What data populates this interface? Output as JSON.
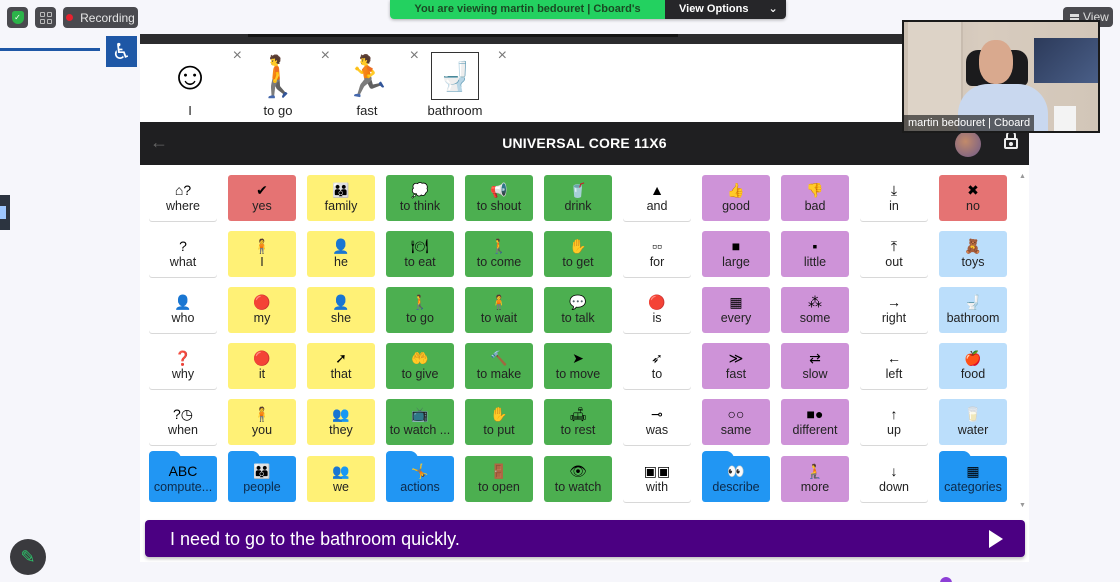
{
  "zoom": {
    "recording_label": "Recording",
    "banner_text": "You are viewing martin bedouret | Cboard's screen",
    "view_options_label": "View Options",
    "view_options_chevron": "⌄",
    "view_label": "View",
    "video_name": "martin bedouret | Cboard",
    "colors": {
      "banner": "#23d160",
      "recording_dot": "#e8212f"
    }
  },
  "left_panel": {
    "access_icon": "wheelchair-icon",
    "access_glyph": "♿",
    "pencil_glyph": "✎"
  },
  "cboard": {
    "output": [
      {
        "label": "I",
        "icon": "person-self-icon",
        "glyph": "☺"
      },
      {
        "label": "to go",
        "icon": "person-walking-icon",
        "glyph": "🚶"
      },
      {
        "label": "fast",
        "icon": "running-fast-icon",
        "glyph": "🏃"
      },
      {
        "label": "bathroom",
        "icon": "toilet-icon",
        "glyph": "🚽"
      }
    ],
    "remove_glyph": "×",
    "board_title": "UNIVERSAL CORE 11X6",
    "back_glyph": "←",
    "phrase": "I need to go to the bathroom quickly.",
    "colors": {
      "phrase_bar": "#4b0082",
      "nav_bar": "#1f1f21",
      "red": "#e57373",
      "yellow": "#fff176",
      "green": "#4caf50",
      "purple": "#ce93d8",
      "light_blue": "#bbdefb",
      "folder_blue": "#2196f3"
    },
    "tiles": [
      [
        {
          "label": "where",
          "type": "white",
          "glyph": "⌂?"
        },
        {
          "label": "yes",
          "type": "red",
          "glyph": "✔"
        },
        {
          "label": "family",
          "type": "yellow",
          "glyph": "👪"
        },
        {
          "label": "to think",
          "type": "green",
          "glyph": "💭"
        },
        {
          "label": "to shout",
          "type": "green",
          "glyph": "📢"
        },
        {
          "label": "drink",
          "type": "green",
          "glyph": "🥤"
        },
        {
          "label": "and",
          "type": "white",
          "glyph": "▲"
        },
        {
          "label": "good",
          "type": "purple",
          "glyph": "👍"
        },
        {
          "label": "bad",
          "type": "purple",
          "glyph": "👎"
        },
        {
          "label": "in",
          "type": "white",
          "glyph": "⤓"
        },
        {
          "label": "no",
          "type": "red",
          "glyph": "✖"
        }
      ],
      [
        {
          "label": "what",
          "type": "white",
          "glyph": "?"
        },
        {
          "label": "I",
          "type": "yellow",
          "glyph": "🧍"
        },
        {
          "label": "he",
          "type": "yellow",
          "glyph": "👤"
        },
        {
          "label": "to eat",
          "type": "green",
          "glyph": "🍽"
        },
        {
          "label": "to come",
          "type": "green",
          "glyph": "🚶"
        },
        {
          "label": "to get",
          "type": "green",
          "glyph": "✋"
        },
        {
          "label": "for",
          "type": "white",
          "glyph": "▫▫"
        },
        {
          "label": "large",
          "type": "purple",
          "glyph": "■"
        },
        {
          "label": "little",
          "type": "purple",
          "glyph": "▪"
        },
        {
          "label": "out",
          "type": "white",
          "glyph": "⤒"
        },
        {
          "label": "toys",
          "type": "lightblue",
          "glyph": "🧸"
        }
      ],
      [
        {
          "label": "who",
          "type": "white",
          "glyph": "👤"
        },
        {
          "label": "my",
          "type": "yellow",
          "glyph": "🔴"
        },
        {
          "label": "she",
          "type": "yellow",
          "glyph": "👤"
        },
        {
          "label": "to go",
          "type": "green",
          "glyph": "🚶"
        },
        {
          "label": "to wait",
          "type": "green",
          "glyph": "🧍"
        },
        {
          "label": "to talk",
          "type": "green",
          "glyph": "💬"
        },
        {
          "label": "is",
          "type": "white",
          "glyph": "🔴"
        },
        {
          "label": "every",
          "type": "purple",
          "glyph": "▦"
        },
        {
          "label": "some",
          "type": "purple",
          "glyph": "⁂"
        },
        {
          "label": "right",
          "type": "white",
          "glyph": "→"
        },
        {
          "label": "bathroom",
          "type": "lightblue",
          "glyph": "🚽"
        }
      ],
      [
        {
          "label": "why",
          "type": "white",
          "glyph": "❓"
        },
        {
          "label": "it",
          "type": "yellow",
          "glyph": "🔴"
        },
        {
          "label": "that",
          "type": "yellow",
          "glyph": "➚"
        },
        {
          "label": "to give",
          "type": "green",
          "glyph": "🤲"
        },
        {
          "label": "to make",
          "type": "green",
          "glyph": "🔨"
        },
        {
          "label": "to move",
          "type": "green",
          "glyph": "➤"
        },
        {
          "label": "to",
          "type": "white",
          "glyph": "➶"
        },
        {
          "label": "fast",
          "type": "purple",
          "glyph": "≫"
        },
        {
          "label": "slow",
          "type": "purple",
          "glyph": "⇄"
        },
        {
          "label": "left",
          "type": "white",
          "glyph": "←"
        },
        {
          "label": "food",
          "type": "lightblue",
          "glyph": "🍎"
        }
      ],
      [
        {
          "label": "when",
          "type": "white",
          "glyph": "?◷"
        },
        {
          "label": "you",
          "type": "yellow",
          "glyph": "🧍"
        },
        {
          "label": "they",
          "type": "yellow",
          "glyph": "👥"
        },
        {
          "label": "to watch ...",
          "type": "green",
          "glyph": "📺"
        },
        {
          "label": "to put",
          "type": "green",
          "glyph": "✋"
        },
        {
          "label": "to rest",
          "type": "green",
          "glyph": "🛋"
        },
        {
          "label": "was",
          "type": "white",
          "glyph": "⊸"
        },
        {
          "label": "same",
          "type": "purple",
          "glyph": "○○"
        },
        {
          "label": "different",
          "type": "purple",
          "glyph": "■●"
        },
        {
          "label": "up",
          "type": "white",
          "glyph": "↑"
        },
        {
          "label": "water",
          "type": "lightblue",
          "glyph": "🥛"
        }
      ],
      [
        {
          "label": "compute...",
          "type": "folder",
          "glyph": "ABC"
        },
        {
          "label": "people",
          "type": "folder",
          "glyph": "👪"
        },
        {
          "label": "we",
          "type": "yellow",
          "glyph": "👥"
        },
        {
          "label": "actions",
          "type": "folder",
          "glyph": "🤸"
        },
        {
          "label": "to open",
          "type": "green",
          "glyph": "🚪"
        },
        {
          "label": "to watch",
          "type": "green",
          "glyph": "👁"
        },
        {
          "label": "with",
          "type": "white",
          "glyph": "▣▣"
        },
        {
          "label": "describe",
          "type": "folder",
          "glyph": "👀"
        },
        {
          "label": "more",
          "type": "purple",
          "glyph": "🧎"
        },
        {
          "label": "down",
          "type": "white",
          "glyph": "↓"
        },
        {
          "label": "categories",
          "type": "folder",
          "glyph": "▦"
        }
      ]
    ]
  }
}
